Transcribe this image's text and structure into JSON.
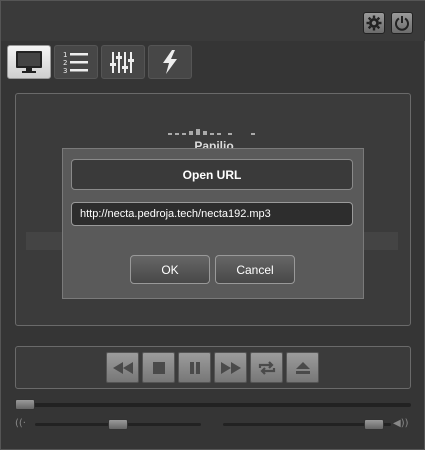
{
  "topbar": {
    "buttons": [
      {
        "name": "settings",
        "icon": "gear-icon"
      },
      {
        "name": "power",
        "icon": "power-icon"
      }
    ]
  },
  "tabs": [
    {
      "name": "display",
      "icon": "monitor-icon",
      "active": true
    },
    {
      "name": "playlist",
      "icon": "numbered-list-icon",
      "active": false
    },
    {
      "name": "equalizer",
      "icon": "sliders-icon",
      "active": false
    },
    {
      "name": "effects",
      "icon": "lightning-icon",
      "active": false
    }
  ],
  "now_playing": {
    "title": "Papilio"
  },
  "dialog": {
    "title": "Open URL",
    "url_value": "http://necta.pedroja.tech/necta192.mp3",
    "ok_label": "OK",
    "cancel_label": "Cancel"
  },
  "transport": [
    {
      "name": "rewind",
      "icon": "rewind-icon"
    },
    {
      "name": "stop",
      "icon": "stop-icon"
    },
    {
      "name": "pause",
      "icon": "pause-icon"
    },
    {
      "name": "fast-forward",
      "icon": "fast-forward-icon"
    },
    {
      "name": "repeat",
      "icon": "repeat-icon"
    },
    {
      "name": "eject",
      "icon": "eject-icon"
    }
  ],
  "sliders": {
    "seek_position": 0.0,
    "balance_position": 0.5,
    "volume_position": 0.95
  },
  "colors": {
    "background": "#353535",
    "panel": "#3b3b3b",
    "dialog": "#5a5a5a",
    "button_gradient_top": "#9c9c9c",
    "active_tab": "#e0e0e0"
  }
}
